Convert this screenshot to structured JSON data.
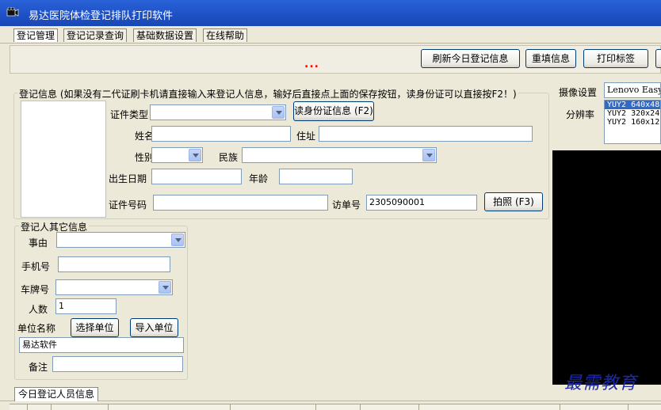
{
  "window": {
    "title": "易达医院体检登记排队打印软件"
  },
  "menu": {
    "tabs": [
      "登记管理",
      "登记记录查询",
      "基础数据设置",
      "在线帮助"
    ]
  },
  "toolbar": {
    "dots": "...",
    "refresh_label": "刷新今日登记信息",
    "refill_label": "重填信息",
    "print_label": "打印标签"
  },
  "register": {
    "legend": "登记信息 (如果没有二代证刷卡机请直接输入来登记人信息，输好后直接点上面的保存按钮，读身份证可以直接按F2！)",
    "cert_type_label": "证件类型",
    "cert_type_value": "",
    "read_id_label": "读身份证信息 (F2)",
    "name_label": "姓名",
    "name_value": "",
    "address_label": "住址",
    "address_value": "",
    "gender_label": "性别",
    "gender_value": "",
    "ethnic_label": "民族",
    "ethnic_value": "",
    "birth_label": "出生日期",
    "birth_value": "",
    "age_label": "年龄",
    "age_value": "",
    "cert_no_label": "证件号码",
    "cert_no_value": "",
    "visit_no_label": "访单号",
    "visit_no_value": "2305090001",
    "photo_label": "拍照 (F3)"
  },
  "other": {
    "legend": "登记人其它信息",
    "reason_label": "事由",
    "reason_value": "",
    "phone_label": "手机号",
    "phone_value": "",
    "plate_label": "车牌号",
    "plate_value": "",
    "count_label": "人数",
    "count_value": "1",
    "unit_label": "单位名称",
    "select_unit_label": "选择单位",
    "import_unit_label": "导入单位",
    "unit_value": "易达软件",
    "note_label": "备注",
    "note_value": ""
  },
  "camera": {
    "device_label": "摄像设置",
    "device_value": "Lenovo Easy",
    "resolution_label": "分辨率",
    "resolutions": [
      "YUY2 640x48",
      "YUY2 320x24",
      "YUY2 160x12"
    ]
  },
  "watermark": "最需教育",
  "bottom": {
    "tab_label": "今日登记人员信息"
  }
}
